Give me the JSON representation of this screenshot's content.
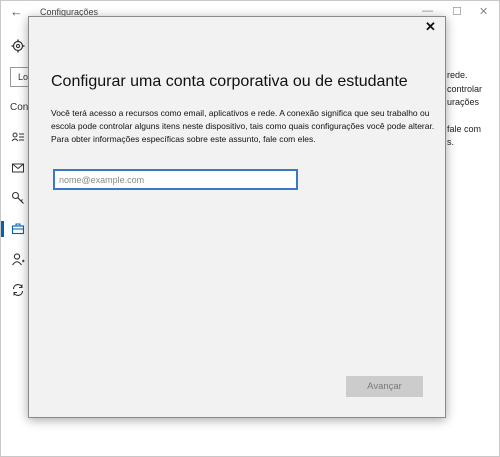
{
  "window": {
    "title": "Configurações",
    "back_icon": "←",
    "minimize_icon": "—",
    "maximize_icon": "☐",
    "close_icon": "✕"
  },
  "sidebar": {
    "search_text": "Lo",
    "section_label": "Cont",
    "icons": [
      "gear-icon",
      "account-info-icon",
      "mail-icon",
      "key-icon",
      "briefcase-icon",
      "person-icon",
      "sync-icon"
    ]
  },
  "background_text": {
    "line1": "rede.",
    "line2": "controlar",
    "line3": "urações",
    "line4": "fale com",
    "line5": "s."
  },
  "dialog": {
    "close_icon": "✕",
    "title": "Configurar uma conta corporativa ou de estudante",
    "description": "Você terá acesso a recursos como email, aplicativos e rede. A conexão significa que seu trabalho ou escola pode controlar alguns itens neste dispositivo, tais como quais configurações você pode alterar. Para obter informações específicas sobre este assunto, fale com eles.",
    "email_placeholder": "nome@example.com",
    "email_value": "",
    "next_label": "Avançar",
    "accent_color": "#3c78c8"
  }
}
